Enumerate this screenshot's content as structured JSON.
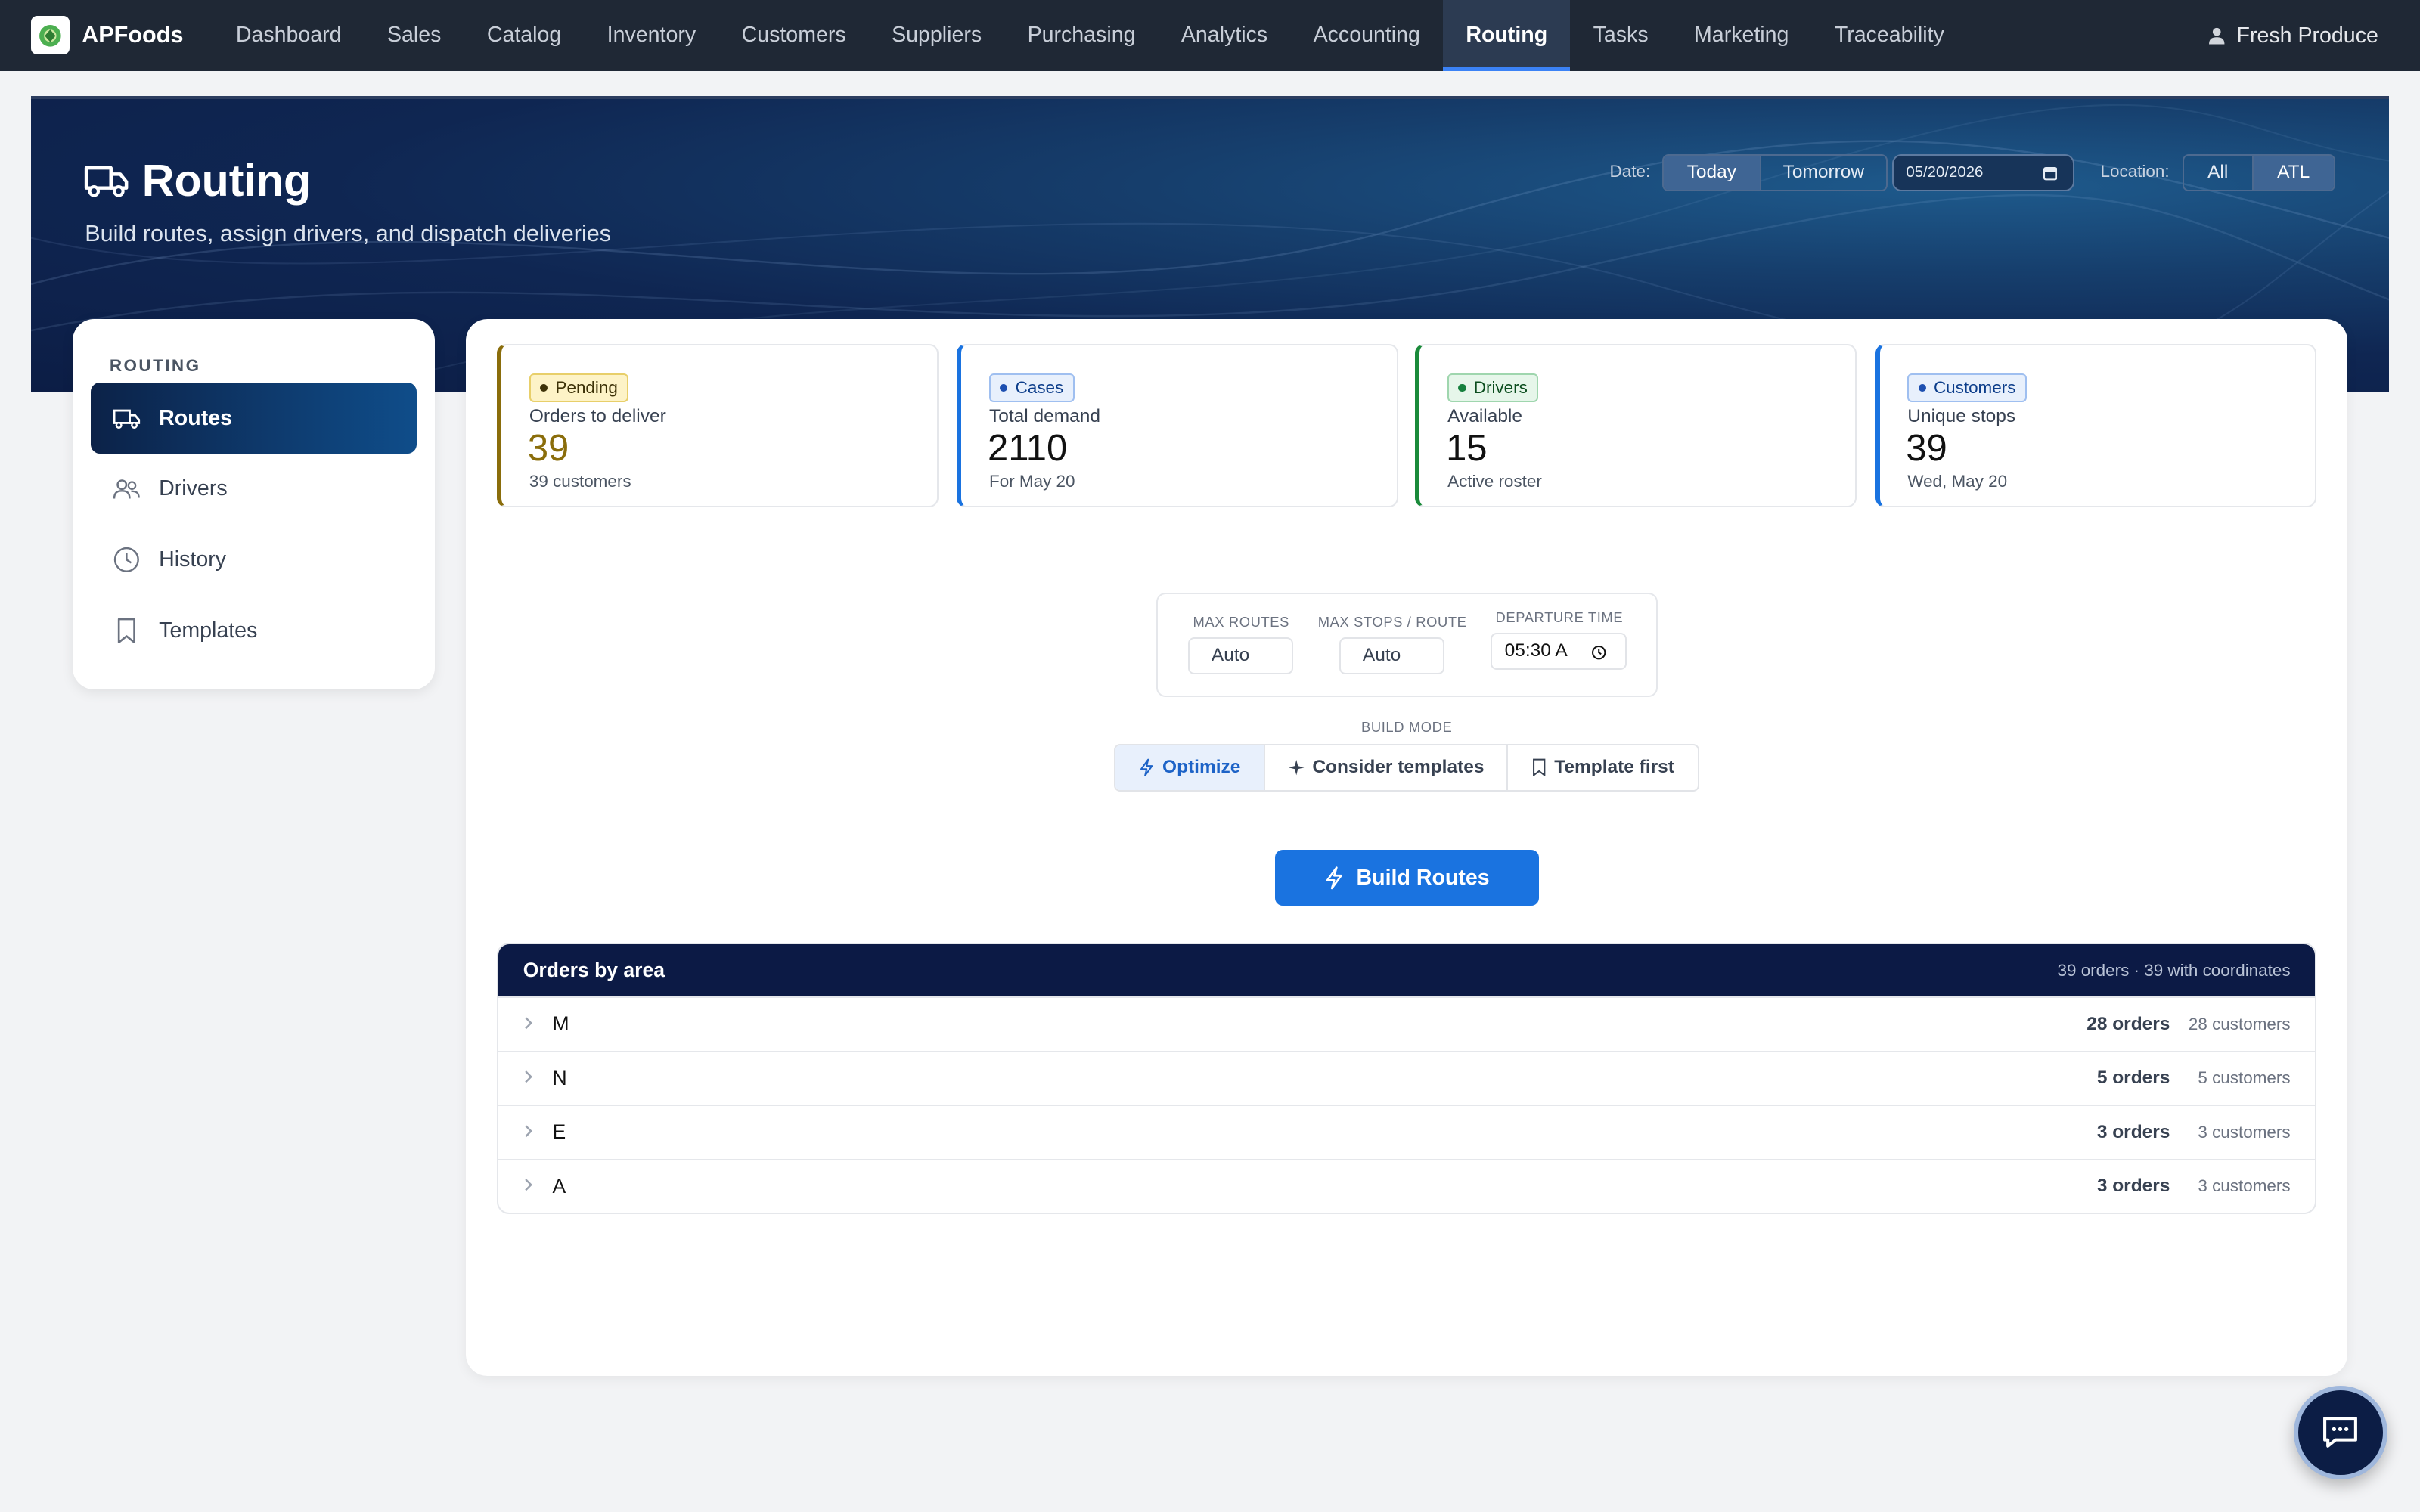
{
  "app": {
    "name": "APFoods"
  },
  "nav": {
    "items": [
      "Dashboard",
      "Sales",
      "Catalog",
      "Inventory",
      "Customers",
      "Suppliers",
      "Purchasing",
      "Analytics",
      "Accounting",
      "Routing",
      "Tasks",
      "Marketing",
      "Traceability"
    ],
    "active": "Routing",
    "user": "Fresh Produce"
  },
  "hero": {
    "title": "Routing",
    "subtitle": "Build routes, assign drivers, and dispatch deliveries",
    "date_label": "Date:",
    "date_options": [
      "Today",
      "Tomorrow"
    ],
    "date_selected": "Today",
    "date_value": "05/20/2026",
    "location_label": "Location:",
    "location_options": [
      "All",
      "ATL"
    ],
    "location_selected": "ATL"
  },
  "sidebar": {
    "heading": "ROUTING",
    "items": [
      {
        "label": "Routes",
        "icon": "truck-icon",
        "active": true
      },
      {
        "label": "Drivers",
        "icon": "users-icon",
        "active": false
      },
      {
        "label": "History",
        "icon": "clock-icon",
        "active": false
      },
      {
        "label": "Templates",
        "icon": "bookmark-icon",
        "active": false
      }
    ]
  },
  "stats": [
    {
      "badge": "Pending",
      "label": "Orders to deliver",
      "value": "39",
      "sub": "39 customers",
      "accent": "#8a6d0b",
      "badge_bg": "#fdf3c7",
      "badge_border": "#e8cf6a",
      "badge_color": "#3d3208",
      "dot": "#3d3208"
    },
    {
      "badge": "Cases",
      "label": "Total demand",
      "value": "2110",
      "sub": "For May 20",
      "accent": "#1a73e0",
      "badge_bg": "#e8f0fc",
      "badge_border": "#9fbff0",
      "badge_color": "#0c3d8a",
      "dot": "#1d4fb0"
    },
    {
      "badge": "Drivers",
      "label": "Available",
      "value": "15",
      "sub": "Active roster",
      "accent": "#1a8a3a",
      "badge_bg": "#e6f6ea",
      "badge_border": "#9fd6ae",
      "badge_color": "#0b4d1e",
      "dot": "#15803d"
    },
    {
      "badge": "Customers",
      "label": "Unique stops",
      "value": "39",
      "sub": "Wed, May 20",
      "accent": "#1a73e0",
      "badge_bg": "#e8f0fc",
      "badge_border": "#9fbff0",
      "badge_color": "#0c3d8a",
      "dot": "#1d4fb0"
    }
  ],
  "options": {
    "max_routes_label": "MAX ROUTES",
    "max_routes_placeholder": "Auto",
    "max_stops_label": "MAX STOPS / ROUTE",
    "max_stops_placeholder": "Auto",
    "departure_label": "DEPARTURE TIME",
    "departure_value": "05:30 A"
  },
  "build_mode": {
    "label": "BUILD MODE",
    "options": [
      {
        "label": "Optimize",
        "icon": "bolt-icon",
        "active": true
      },
      {
        "label": "Consider templates",
        "icon": "sparkle-icon",
        "active": false
      },
      {
        "label": "Template first",
        "icon": "bookmark-icon",
        "active": false
      }
    ]
  },
  "build_button": "Build Routes",
  "areas": {
    "title": "Orders by area",
    "summary": "39 orders · 39 with coordinates",
    "rows": [
      {
        "name": "M",
        "orders": "28 orders",
        "customers": "28 customers"
      },
      {
        "name": "N",
        "orders": "5 orders",
        "customers": "5 customers"
      },
      {
        "name": "E",
        "orders": "3 orders",
        "customers": "3 customers"
      },
      {
        "name": "A",
        "orders": "3 orders",
        "customers": "3 customers"
      }
    ]
  },
  "chat": {
    "icon": "chat-icon"
  }
}
